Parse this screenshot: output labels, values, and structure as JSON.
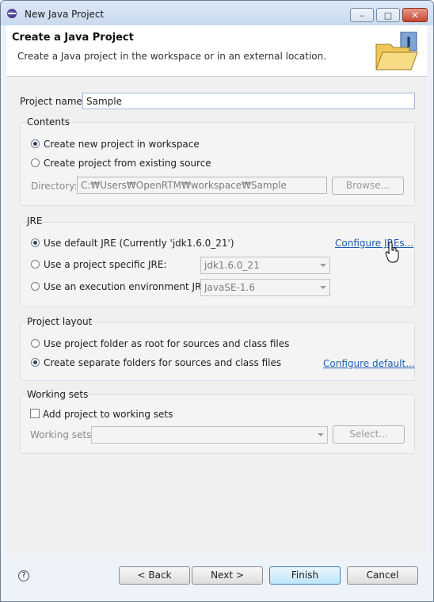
{
  "window": {
    "title": "New Java Project",
    "controls": {
      "minimize": "–",
      "maximize": "□",
      "close": "✕"
    }
  },
  "banner": {
    "title": "Create a Java Project",
    "description": "Create a Java project in the workspace or in an external location.",
    "icon": "java-project-folder-icon"
  },
  "project_name": {
    "label": "Project name:",
    "value": "Sample"
  },
  "contents": {
    "title": "Contents",
    "options": [
      "Create new project in workspace",
      "Create project from existing source"
    ],
    "selected": 0,
    "directory_label": "Directory:",
    "directory_value": "C:₩Users₩OpenRTM₩workspace₩Sample",
    "browse_label": "Browse..."
  },
  "jre": {
    "title": "JRE",
    "options": [
      "Use default JRE (Currently 'jdk1.6.0_21')",
      "Use a project specific JRE:",
      "Use an execution environment JRE:"
    ],
    "selected": 0,
    "configure_link": "Configure JREs...",
    "specific_value": "jdk1.6.0_21",
    "environment_value": "JavaSE-1.6"
  },
  "layout": {
    "title": "Project layout",
    "options": [
      "Use project folder as root for sources and class files",
      "Create separate folders for sources and class files"
    ],
    "selected": 1,
    "configure_link": "Configure default..."
  },
  "working_sets": {
    "title": "Working sets",
    "add_label": "Add project to working sets",
    "checked": false,
    "sets_label": "Working sets:",
    "sets_value": "",
    "select_label": "Select..."
  },
  "footer": {
    "help": "?",
    "back": "< Back",
    "next": "Next >",
    "finish": "Finish",
    "cancel": "Cancel"
  }
}
